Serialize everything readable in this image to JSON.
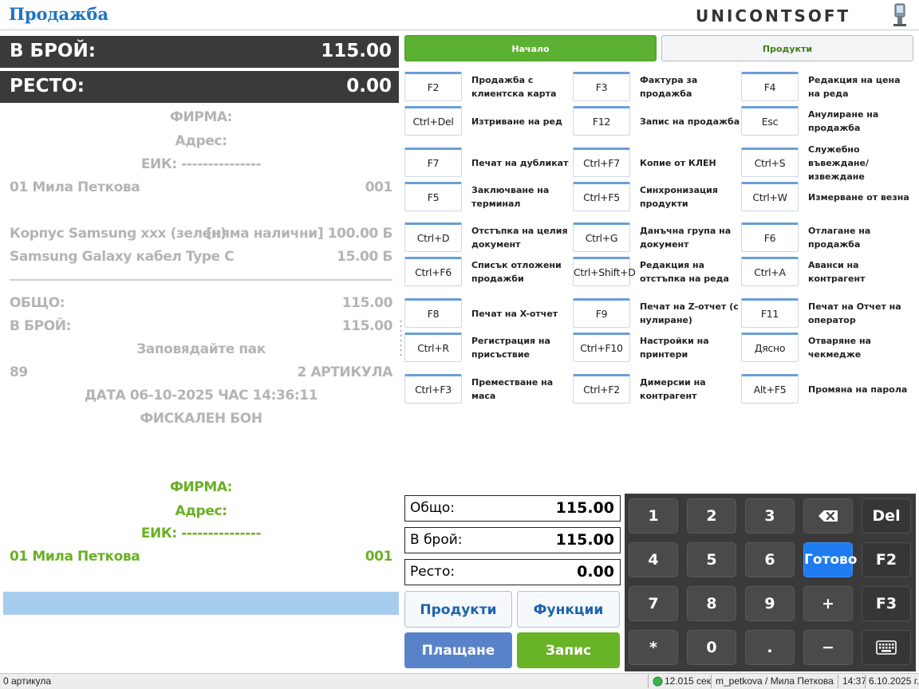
{
  "window": {
    "title": "Продажба",
    "logo_text": "UNICONTSOFT"
  },
  "summary": {
    "cash_label": "В БРОЙ:",
    "cash_value": "115.00",
    "change_label": "РЕСТО:",
    "change_value": "0.00"
  },
  "receipt": {
    "company": "ФИРМА:",
    "address": "Адрес:",
    "eik": "ЕИК: ---------------",
    "operator_name": "01 Мила Петкова",
    "operator_code": "001",
    "items": [
      {
        "name": "Корпус Samsung xxx (зелен)",
        "note": "[няма налични]",
        "amount": "100.00 Б"
      },
      {
        "name": "Samsung Galaxy кабел Type C",
        "note": "",
        "amount": "15.00 Б"
      }
    ],
    "total_label": "ОБЩО:",
    "total_value": "115.00",
    "cash_label": "В БРОЙ:",
    "cash_value": "115.00",
    "thanks": "Заповядайте пак",
    "receipt_no": "89",
    "articles_count": "2 АРТИКУЛА",
    "datetime": "ДАТА 06-10-2025  ЧАС 14:36:11",
    "fiscal": "ФИСКАЛЕН БОН",
    "next_company": "ФИРМА:",
    "next_address": "Адрес:",
    "next_eik": "ЕИК: ---------------",
    "next_operator_name": "01 Мила Петкова",
    "next_operator_code": "001"
  },
  "tabs": {
    "home": "Начало",
    "products": "Продукти"
  },
  "functions": [
    {
      "key": "F2",
      "label": "Продажба с клиентска карта"
    },
    {
      "key": "F3",
      "label": "Фактура за продажба"
    },
    {
      "key": "F4",
      "label": "Редакция на цена на реда"
    },
    {
      "key": "Ctrl+Del",
      "label": "Изтриване на ред"
    },
    {
      "key": "F12",
      "label": "Запис на продажба"
    },
    {
      "key": "Esc",
      "label": "Анулиране на продажба"
    },
    {
      "key": "F7",
      "label": "Печат на дубликат"
    },
    {
      "key": "Ctrl+F7",
      "label": "Копие от КЛЕН"
    },
    {
      "key": "Ctrl+S",
      "label": "Служебно въвеждане/извеждане"
    },
    {
      "key": "F5",
      "label": "Заключване на терминал"
    },
    {
      "key": "Ctrl+F5",
      "label": "Синхронизация продукти"
    },
    {
      "key": "Ctrl+W",
      "label": "Измерване от везна"
    },
    {
      "key": "Ctrl+D",
      "label": "Отстъпка на целия документ"
    },
    {
      "key": "Ctrl+G",
      "label": "Данъчна група на документ"
    },
    {
      "key": "F6",
      "label": "Отлагане на продажба"
    },
    {
      "key": "Ctrl+F6",
      "label": "Списък отложени продажби"
    },
    {
      "key": "Ctrl+Shift+D",
      "label": "Редакция на отстъпка на реда"
    },
    {
      "key": "Ctrl+A",
      "label": "Аванси на контрагент"
    },
    {
      "key": "F8",
      "label": "Печат на X-отчет"
    },
    {
      "key": "F9",
      "label": "Печат на Z-отчет (с нулиране)"
    },
    {
      "key": "F11",
      "label": "Печат на Отчет на оператор"
    },
    {
      "key": "Ctrl+R",
      "label": "Регистрация на присъствие"
    },
    {
      "key": "Ctrl+F10",
      "label": "Настройки на принтери"
    },
    {
      "key": "Дясно",
      "label": "Отваряне на чекмедже"
    },
    {
      "key": "Ctrl+F3",
      "label": "Преместване на маса"
    },
    {
      "key": "Ctrl+F2",
      "label": "Димерсии на контрагент"
    },
    {
      "key": "Alt+F5",
      "label": "Промяна на парола"
    }
  ],
  "totals": {
    "total_label": "Общо:",
    "total_value": "115.00",
    "cash_label": "В брой:",
    "cash_value": "115.00",
    "change_label": "Ресто:",
    "change_value": "0.00"
  },
  "actions": {
    "products": "Продукти",
    "functions": "Функции",
    "pay": "Плащане",
    "save": "Запис"
  },
  "keypad": {
    "k1": "1",
    "k2": "2",
    "k3": "3",
    "del": "Del",
    "k4": "4",
    "k5": "5",
    "k6": "6",
    "done": "Готово",
    "f2": "F2",
    "k7": "7",
    "k8": "8",
    "k9": "9",
    "plus": "+",
    "f3": "F3",
    "star": "*",
    "k0": "0",
    "dot": ".",
    "minus": "−"
  },
  "status": {
    "articles": "0 артикула",
    "time_sec": "12.015 сек",
    "user": "m_petkova / Мила Петкова",
    "time": "14:37",
    "date": "6.10.2025 г."
  }
}
